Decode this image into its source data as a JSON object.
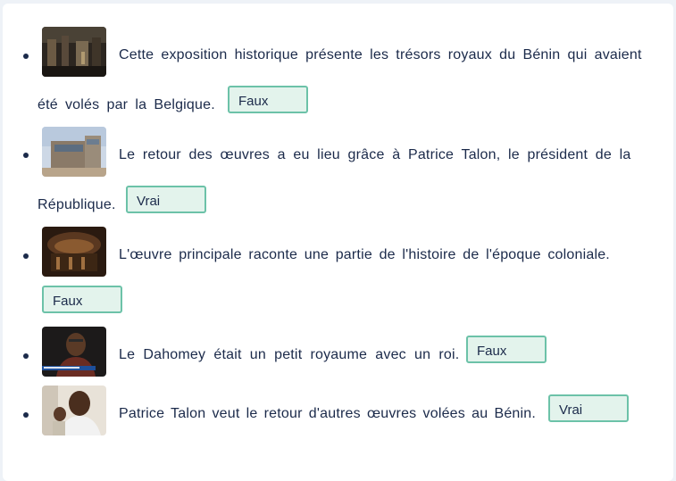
{
  "items": [
    {
      "line1": "Cette exposition historique présente les trésors royaux du Bénin qui avaient",
      "line2": "été volés par la Belgique.",
      "answer": "Faux",
      "thumb_icon": "museum-gallery-photo"
    },
    {
      "line1": "Le retour des œuvres a eu lieu grâce à Patrice Talon, le président de la",
      "line2": "République.",
      "answer": "Vrai",
      "thumb_icon": "building-photo"
    },
    {
      "line1": "L'œuvre principale raconte une partie de l'histoire de l'époque coloniale.",
      "answer": "Faux",
      "thumb_icon": "artwork-photo"
    },
    {
      "line1": "Le Dahomey était un petit royaume avec un roi.",
      "answer": "Faux",
      "thumb_icon": "man-interview-photo"
    },
    {
      "line1": "Patrice Talon veut le retour d'autres œuvres volées au Bénin.",
      "answer": "Vrai",
      "thumb_icon": "man-speaking-photo"
    }
  ],
  "colors": {
    "text": "#1b2a4a",
    "answer_border": "#6cc2a8",
    "answer_bg": "#e3f3ec"
  }
}
